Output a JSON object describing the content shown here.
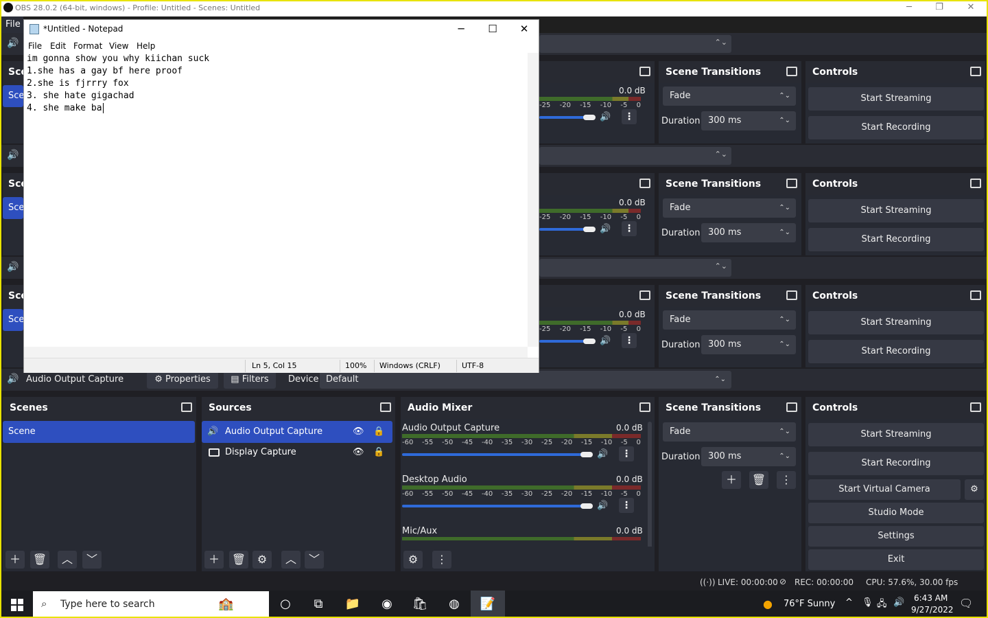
{
  "window": {
    "title": "OBS 28.0.2 (64-bit, windows) - Profile: Untitled - Scenes: Untitled",
    "min": "─",
    "max": "❐",
    "close": "✕"
  },
  "menubar": {
    "file": "File"
  },
  "docks": {
    "scenes": "Scenes",
    "sources": "Sources",
    "audio_mixer": "Audio Mixer",
    "scene_transitions": "Scene Transitions",
    "controls": "Controls",
    "scene_truncated": "Sce"
  },
  "source_toolbar": {
    "source": "Audio Output Capture",
    "properties": "Properties",
    "filters": "Filters",
    "device_label": "Device",
    "device_value": "Default"
  },
  "scenes": {
    "items": [
      "Scene"
    ]
  },
  "sources": {
    "items": [
      {
        "name": "Audio Output Capture",
        "icon": "speaker-icon"
      },
      {
        "name": "Display Capture",
        "icon": "monitor-icon"
      }
    ]
  },
  "mixer": {
    "channels": [
      {
        "name": "Audio Output Capture",
        "db": "0.0 dB",
        "volume": 1.0
      },
      {
        "name": "Desktop Audio",
        "db": "0.0 dB",
        "volume": 1.0
      },
      {
        "name": "Mic/Aux",
        "db": "0.0 dB",
        "volume": 1.0
      }
    ],
    "ticks": [
      "-60",
      "-55",
      "-50",
      "-45",
      "-40",
      "-35",
      "-30",
      "-25",
      "-20",
      "-15",
      "-10",
      "-5",
      "0"
    ],
    "ticks_partial": [
      "-25",
      "-20",
      "-15",
      "-10",
      "-5",
      "0"
    ]
  },
  "transitions": {
    "type": "Fade",
    "duration_label": "Duration",
    "duration": "300 ms"
  },
  "controls": {
    "start_streaming": "Start Streaming",
    "start_recording": "Start Recording",
    "start_virtual_camera": "Start Virtual Camera",
    "studio_mode": "Studio Mode",
    "settings": "Settings",
    "exit": "Exit"
  },
  "status": {
    "live": "LIVE: 00:00:00",
    "rec": "REC: 00:00:00",
    "cpu": "CPU: 57.6%, 30.00 fps"
  },
  "notepad": {
    "title": "*Untitled - Notepad",
    "menu": [
      "File",
      "Edit",
      "Format",
      "View",
      "Help"
    ],
    "text": "im gonna show you why kiichan suck\n1.she has a gay bf here proof\n2.she is fjrrry fox\n3. she hate gigachad\n4. she make ba",
    "status": {
      "position": "Ln 5, Col 15",
      "zoom": "100%",
      "line_ending": "Windows (CRLF)",
      "encoding": "UTF-8"
    }
  },
  "taskbar": {
    "search_placeholder": "Type here to search",
    "weather": "76°F  Sunny",
    "time": "6:43 AM",
    "date": "9/27/2022"
  },
  "colors": {
    "accent": "#2e4fbf",
    "highlight_border": "#e8e300",
    "slider": "#2f6ad9"
  }
}
